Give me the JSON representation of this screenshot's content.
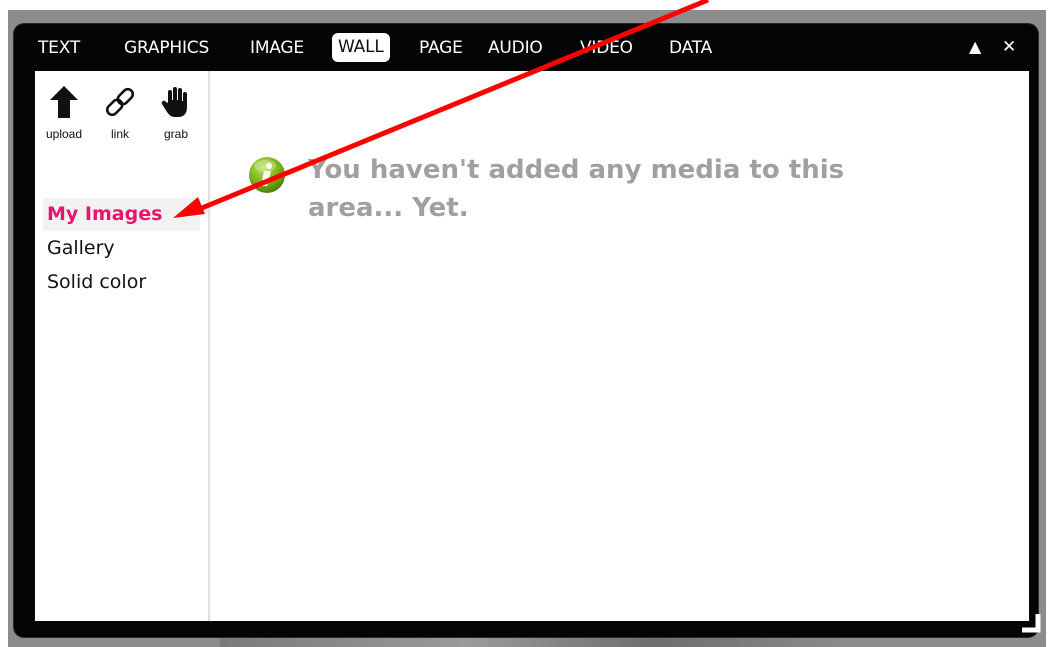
{
  "tabs": [
    {
      "label": "TEXT"
    },
    {
      "label": "GRAPHICS"
    },
    {
      "label": "IMAGE"
    },
    {
      "label": "WALL",
      "active": true
    },
    {
      "label": "PAGE"
    },
    {
      "label": "AUDIO"
    },
    {
      "label": "VIDEO"
    },
    {
      "label": "DATA"
    }
  ],
  "window_controls": {
    "collapse": "▲",
    "close": "✕"
  },
  "tools": [
    {
      "label": "upload",
      "icon": "upload-arrow-icon"
    },
    {
      "label": "link",
      "icon": "link-icon"
    },
    {
      "label": "grab",
      "icon": "hand-icon"
    }
  ],
  "nav": [
    {
      "label": "My Images",
      "active": true
    },
    {
      "label": "Gallery"
    },
    {
      "label": "Solid color"
    }
  ],
  "message": {
    "icon": "info-icon",
    "text": "You haven't added any media to this area... Yet."
  },
  "colors": {
    "accent": "#e8146d",
    "annotation_arrow": "#ff0000",
    "message": "#a0a0a0",
    "info_icon": "#7cb518"
  }
}
